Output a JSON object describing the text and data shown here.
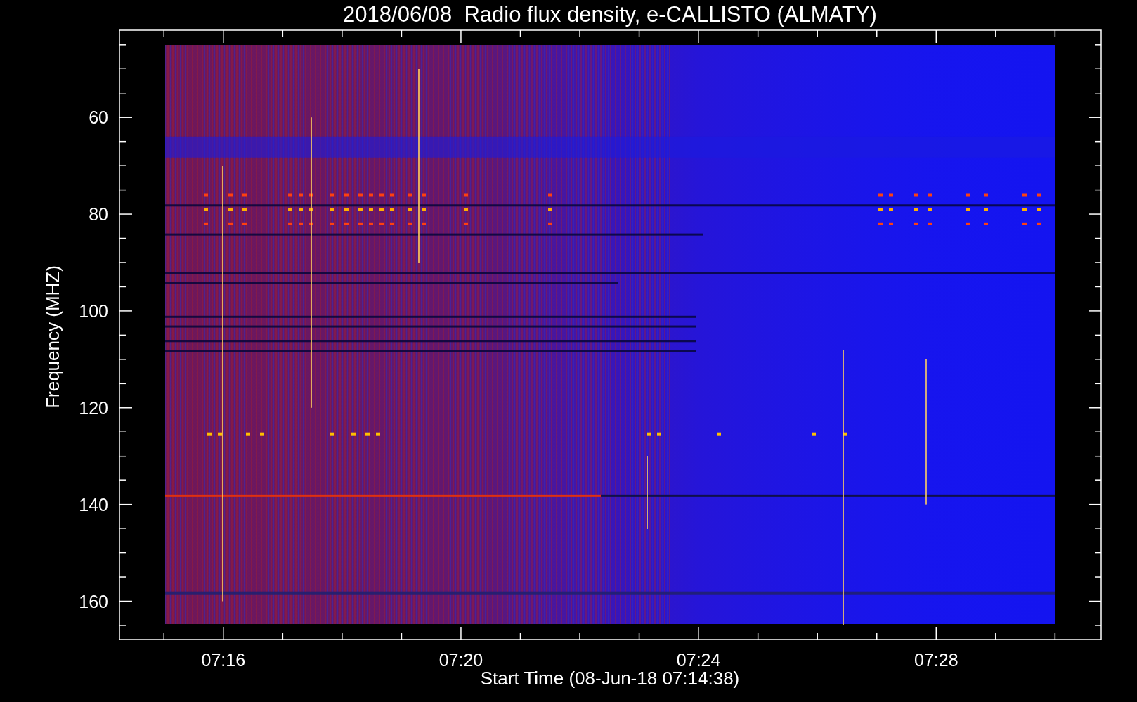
{
  "title": "2018/06/08  Radio flux density, e-CALLISTO (ALMATY)",
  "ylabel": "Frequency (MHZ)",
  "xlabel": "Start Time (08-Jun-18 07:14:38)",
  "yticks": [
    "60",
    "80",
    "100",
    "120",
    "140",
    "160"
  ],
  "xticks": [
    "07:16",
    "07:20",
    "07:24",
    "07:28"
  ]
}
